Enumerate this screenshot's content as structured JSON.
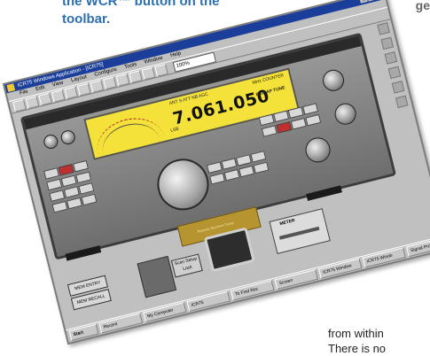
{
  "magazine": {
    "top_left_line1": "the WCR™ button on the",
    "top_left_line2": "toolbar.",
    "top_right": "ge",
    "bottom_right_line1": "from within",
    "bottom_right_line2": "There is no"
  },
  "window": {
    "title": "ICR75 Windows Application - [ICR75]"
  },
  "menu": [
    "File",
    "Edit",
    "View",
    "Layout",
    "Configure",
    "Tools",
    "Window",
    "Help"
  ],
  "toolbar": {
    "zoom_value": "100%"
  },
  "radio": {
    "frequency": "7.061.050",
    "display_top": "ANT S ATT NB AGC",
    "display_right_top": "MHz COUNTER",
    "display_right_mid": "REC AP TUNE",
    "display_mode": "LSB",
    "tuner_label": "Remote Receiver Tuner"
  },
  "widgets": {
    "mem_btn1": "MEM ENTRY",
    "mem_btn2": "MEM RECALL",
    "scan_box": "Scan Setup Lock",
    "meter_label": "METER"
  },
  "taskbar": {
    "items": [
      "Start",
      "Recent",
      "My Computer",
      "ICR75",
      "To Find Rec",
      "Screen",
      "ICR75 Window",
      "ICR75 Windo",
      "Signal Pro"
    ]
  }
}
